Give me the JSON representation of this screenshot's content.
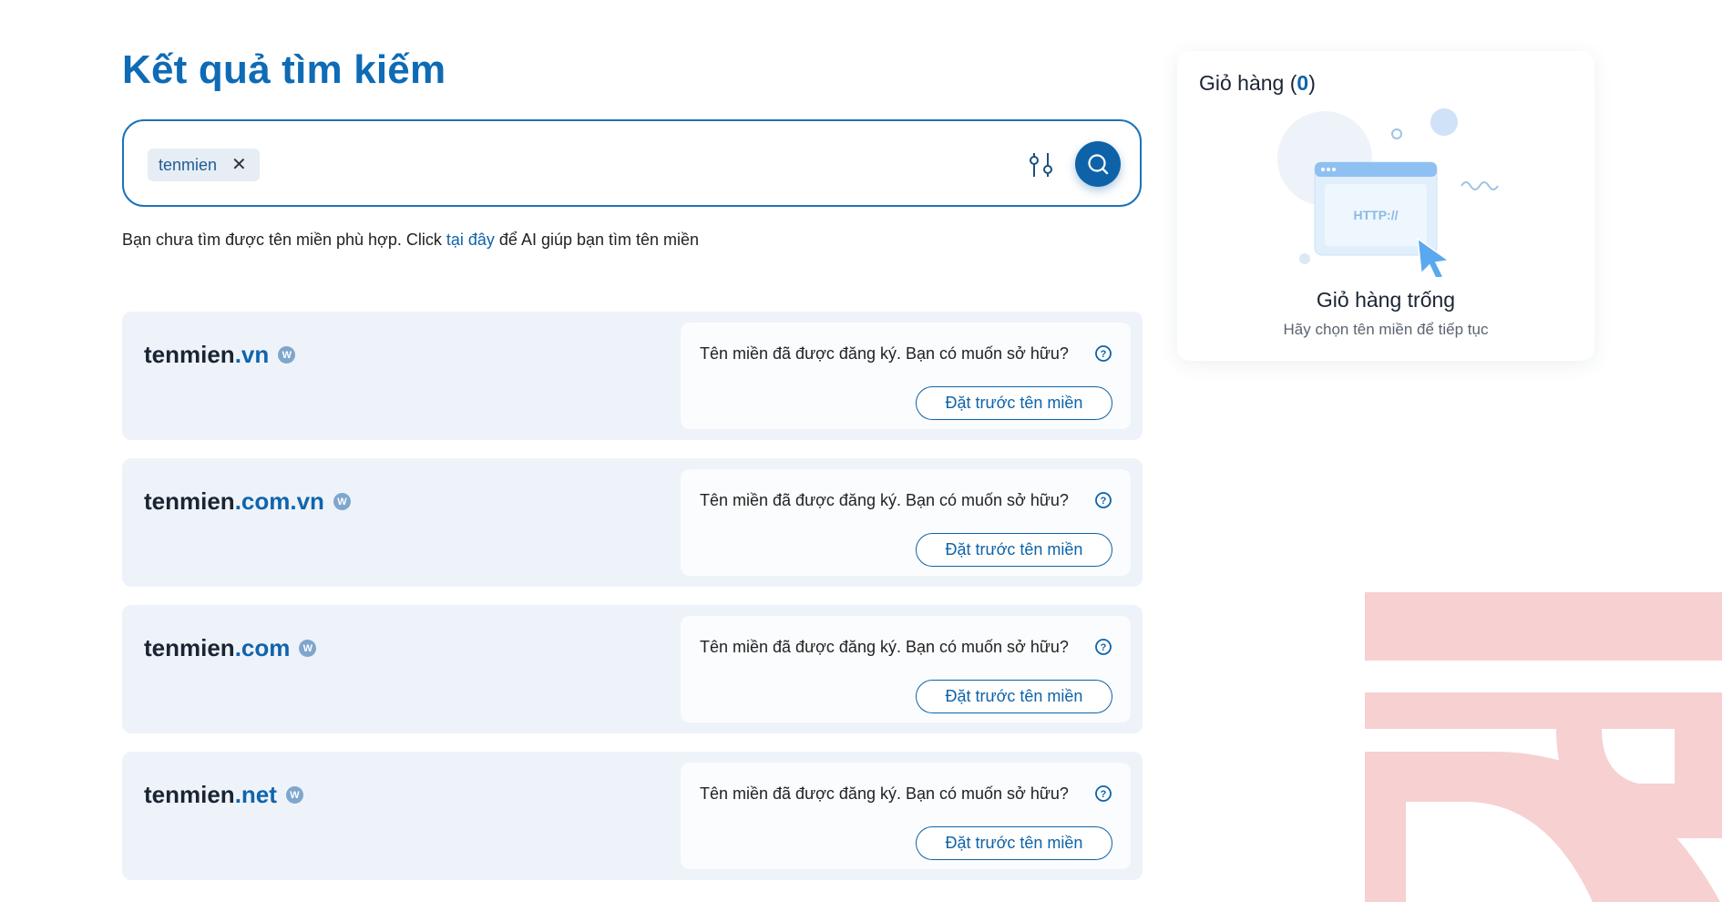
{
  "page": {
    "title": "Kết quả tìm kiếm"
  },
  "search": {
    "chip_label": "tenmien",
    "chip_remove": "✕",
    "filter_icon": "sliders-icon",
    "search_icon": "search-icon"
  },
  "hint": {
    "prefix": "Bạn chưa tìm được tên miền phù hợp. Click ",
    "link": "tại đây",
    "suffix": " để AI giúp bạn tìm tên miền"
  },
  "results": [
    {
      "name": "tenmien",
      "ext": ".vn",
      "badge": "W",
      "status": "Tên miền đã được đăng ký. Bạn có muốn sở hữu?",
      "action": "Đặt trước tên miền"
    },
    {
      "name": "tenmien",
      "ext": ".com.vn",
      "badge": "W",
      "status": "Tên miền đã được đăng ký. Bạn có muốn sở hữu?",
      "action": "Đặt trước tên miền"
    },
    {
      "name": "tenmien",
      "ext": ".com",
      "badge": "W",
      "status": "Tên miền đã được đăng ký. Bạn có muốn sở hữu?",
      "action": "Đặt trước tên miền"
    },
    {
      "name": "tenmien",
      "ext": ".net",
      "badge": "W",
      "status": "Tên miền đã được đăng ký. Bạn có muốn sở hữu?",
      "action": "Đặt trước tên miền"
    }
  ],
  "cart": {
    "title_prefix": "Giỏ hàng (",
    "count": "0",
    "title_suffix": ")",
    "illustration_text": "HTTP://",
    "empty_title": "Giỏ hàng trống",
    "empty_subtitle": "Hãy chọn tên miền để tiếp tục"
  },
  "colors": {
    "accent": "#0e63a8",
    "card_bg": "#eef3f9",
    "watermark": "#f7d0d1"
  }
}
